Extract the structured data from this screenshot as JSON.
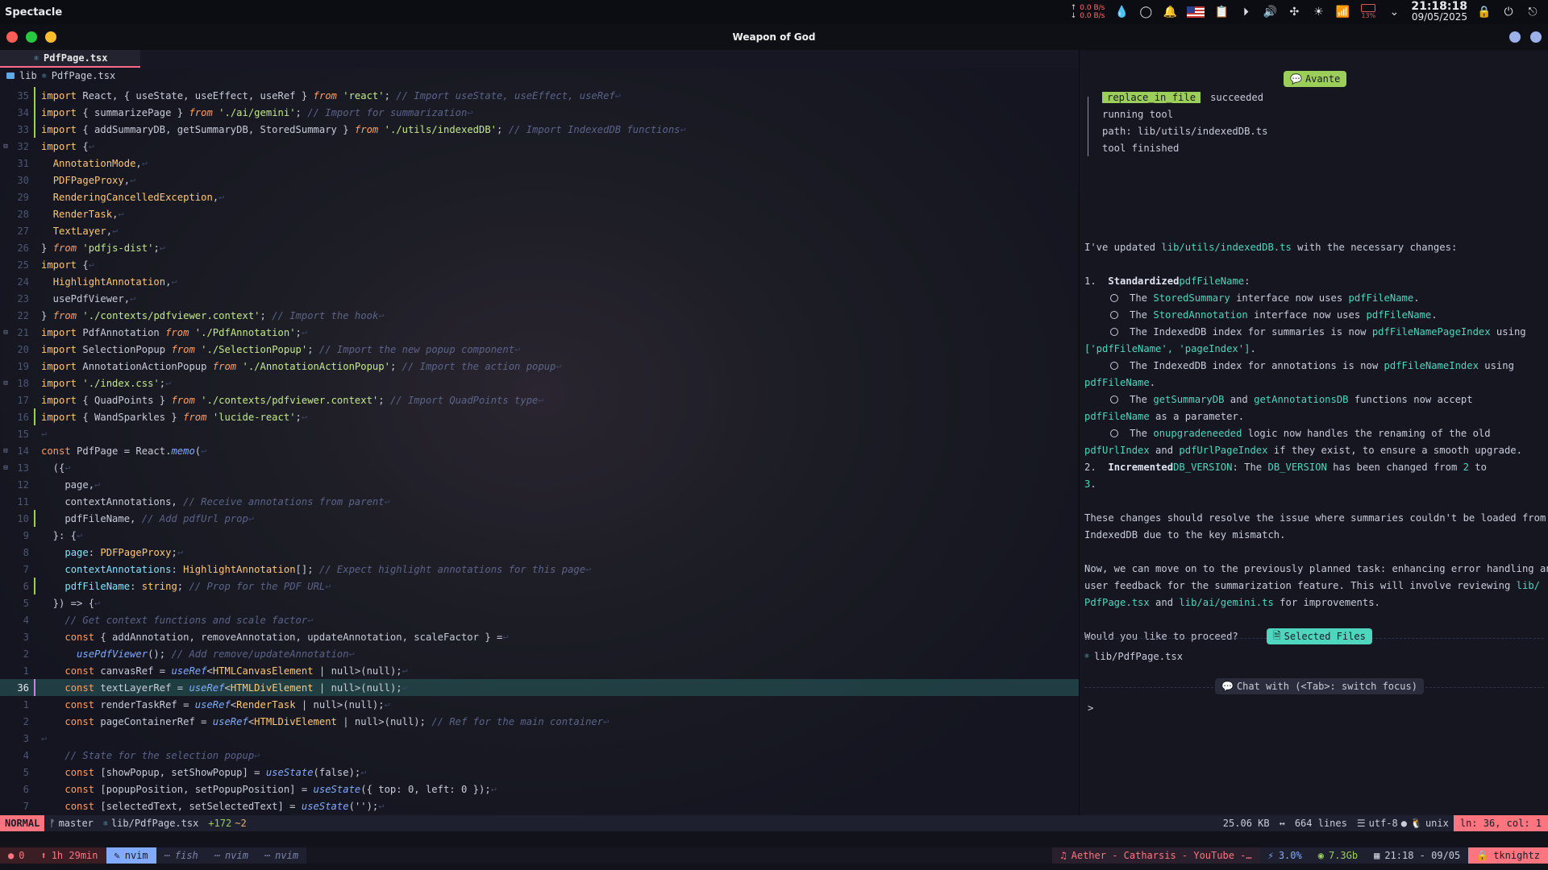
{
  "topbar": {
    "app_name": "Spectacle",
    "net_up": "0.0 B/s",
    "net_down": "0.0 B/s",
    "battery_pct": "13%",
    "time": "21:18:18",
    "date": "09/05/2025"
  },
  "window": {
    "title": "Weapon of God"
  },
  "editor": {
    "tab_label": "PdfPage.tsx",
    "breadcrumb_folder": "lib",
    "breadcrumb_file": "PdfPage.tsx",
    "lines": [
      {
        "n": "35",
        "sign": "add",
        "fold": "",
        "html": "<span class=kwi>import</span> React, { useState, useEffect, useRef } <span class=from>from</span> <span class=str>'react'</span>; <span class=cm>// Import useState, useEffect, useRef</span><span class=eol>↩</span>"
      },
      {
        "n": "34",
        "sign": "add",
        "fold": "",
        "html": "<span class=kwi>import</span> { summarizePage } <span class=from>from</span> <span class=str>'./ai/gemini'</span>; <span class=cm>// Import for summarization</span><span class=eol>↩</span>"
      },
      {
        "n": "33",
        "sign": "add",
        "fold": "",
        "html": "<span class=kwi>import</span> { addSummaryDB, getSummaryDB, StoredSummary } <span class=from>from</span> <span class=str>'./utils/indexedDB'</span>; <span class=cm>// Import IndexedDB functions</span><span class=eol>↩</span>"
      },
      {
        "n": "32",
        "sign": "",
        "fold": "⊟",
        "html": "<span class=kwi>import</span> {<span class=eol>↩</span>"
      },
      {
        "n": "31",
        "sign": "",
        "fold": "",
        "html": "  <span class=ty>AnnotationMode</span>,<span class=eol>↩</span>"
      },
      {
        "n": "30",
        "sign": "",
        "fold": "",
        "html": "  <span class=ty>PDFPageProxy</span>,<span class=eol>↩</span>"
      },
      {
        "n": "29",
        "sign": "",
        "fold": "",
        "html": "  <span class=ty>RenderingCancelledException</span>,<span class=eol>↩</span>"
      },
      {
        "n": "28",
        "sign": "",
        "fold": "",
        "html": "  <span class=ty>RenderTask</span>,<span class=eol>↩</span>"
      },
      {
        "n": "27",
        "sign": "",
        "fold": "",
        "html": "  <span class=ty>TextLayer</span>,<span class=eol>↩</span>"
      },
      {
        "n": "26",
        "sign": "",
        "fold": "",
        "html": "} <span class=from>from</span> <span class=str>'pdfjs-dist'</span>;<span class=eol>↩</span>"
      },
      {
        "n": "25",
        "sign": "",
        "fold": "",
        "html": "<span class=kwi>import</span> {<span class=eol>↩</span>"
      },
      {
        "n": "24",
        "sign": "",
        "fold": "",
        "html": "  <span class=ty>HighlightAnnotation</span>,<span class=eol>↩</span>"
      },
      {
        "n": "23",
        "sign": "",
        "fold": "",
        "html": "  usePdfViewer,<span class=eol>↩</span>"
      },
      {
        "n": "22",
        "sign": "",
        "fold": "",
        "html": "} <span class=from>from</span> <span class=str>'./contexts/pdfviewer.context'</span>; <span class=cm>// Import the hook</span><span class=eol>↩</span>"
      },
      {
        "n": "21",
        "sign": "",
        "fold": "⊟",
        "html": "<span class=kwi>import</span> PdfAnnotation <span class=from>from</span> <span class=str>'./PdfAnnotation'</span>;<span class=eol>↩</span>"
      },
      {
        "n": "20",
        "sign": "",
        "fold": "",
        "html": "<span class=kwi>import</span> SelectionPopup <span class=from>from</span> <span class=str>'./SelectionPopup'</span>; <span class=cm>// Import the new popup component</span><span class=eol>↩</span>"
      },
      {
        "n": "19",
        "sign": "",
        "fold": "",
        "html": "<span class=kwi>import</span> AnnotationActionPopup <span class=from>from</span> <span class=str>'./AnnotationActionPopup'</span>; <span class=cm>// Import the action popup</span><span class=eol>↩</span>"
      },
      {
        "n": "18",
        "sign": "",
        "fold": "⊟",
        "html": "<span class=kwi>import</span> <span class=str>'./index.css'</span>;<span class=eol>↩</span>"
      },
      {
        "n": "17",
        "sign": "",
        "fold": "",
        "html": "<span class=kwi>import</span> { QuadPoints } <span class=from>from</span> <span class=str>'./contexts/pdfviewer.context'</span>; <span class=cm>// Import QuadPoints type</span><span class=eol>↩</span>"
      },
      {
        "n": "16",
        "sign": "add",
        "fold": "",
        "html": "<span class=kwi>import</span> { WandSparkles } <span class=from>from</span> <span class=str>'lucide-react'</span>;<span class=eol>↩</span>"
      },
      {
        "n": "15",
        "sign": "",
        "fold": "",
        "html": "<span class=eol>↩</span>"
      },
      {
        "n": "14",
        "sign": "",
        "fold": "⊟",
        "html": "<span class=kw>const</span> PdfPage = React.<span class=fn>memo</span>(<span class=eol>↩</span>"
      },
      {
        "n": "13",
        "sign": "",
        "fold": "⊟",
        "html": "  ({<span class=eol>↩</span>"
      },
      {
        "n": "12",
        "sign": "",
        "fold": "",
        "html": "    page,<span class=eol>↩</span>"
      },
      {
        "n": "11",
        "sign": "",
        "fold": "",
        "html": "    contextAnnotations, <span class=cm>// Receive annotations from parent</span><span class=eol>↩</span>"
      },
      {
        "n": "10",
        "sign": "add",
        "fold": "",
        "html": "    pdfFileName, <span class=cm>// Add pdfUrl prop</span><span class=eol>↩</span>"
      },
      {
        "n": "9",
        "sign": "",
        "fold": "",
        "html": "  }: {<span class=eol>↩</span>"
      },
      {
        "n": "8",
        "sign": "",
        "fold": "",
        "html": "    <span class=prop>page</span>: <span class=ty>PDFPageProxy</span>;<span class=eol>↩</span>"
      },
      {
        "n": "7",
        "sign": "",
        "fold": "",
        "html": "    <span class=prop>contextAnnotations</span>: <span class=ty>HighlightAnnotation</span>[]; <span class=cm>// Expect highlight annotations for this page</span><span class=eol>↩</span>"
      },
      {
        "n": "6",
        "sign": "add",
        "fold": "",
        "html": "    <span class=prop>pdfFileName</span>: <span class=ty>string</span>; <span class=cm>// Prop for the PDF URL</span><span class=eol>↩</span>"
      },
      {
        "n": "5",
        "sign": "",
        "fold": "",
        "html": "  }) => {<span class=eol>↩</span>"
      },
      {
        "n": "4",
        "sign": "",
        "fold": "",
        "html": "    <span class=cm>// Get context functions and scale factor</span><span class=eol>↩</span>"
      },
      {
        "n": "3",
        "sign": "",
        "fold": "",
        "html": "    <span class=kw>const</span> { addAnnotation, removeAnnotation, updateAnnotation, scaleFactor } =<span class=eol>↩</span>"
      },
      {
        "n": "2",
        "sign": "",
        "fold": "",
        "html": "      <span class=fn>usePdfViewer</span>(); <span class=cm>// Add remove/updateAnnotation</span><span class=eol>↩</span>"
      },
      {
        "n": "1",
        "sign": "",
        "fold": "",
        "html": "    <span class=kw>const</span> canvasRef = <span class=fn>useRef</span>&lt;<span class=ty>HTMLCanvasElement</span> | null&gt;(null);<span class=eol>↩</span>"
      },
      {
        "n": "36",
        "sign": "mod",
        "fold": "",
        "cur": true,
        "html": "    <span class=kw>const</span> textLayerRef = <span class=fn>useRef</span>&lt;<span class=ty>HTMLDivElement</span> | null&gt;(null);<span class=eol>↩</span>"
      },
      {
        "n": "1",
        "sign": "",
        "fold": "",
        "html": "    <span class=kw>const</span> renderTaskRef = <span class=fn>useRef</span>&lt;<span class=ty>RenderTask</span> | null&gt;(null);<span class=eol>↩</span>"
      },
      {
        "n": "2",
        "sign": "",
        "fold": "",
        "html": "    <span class=kw>const</span> pageContainerRef = <span class=fn>useRef</span>&lt;<span class=ty>HTMLDivElement</span> | null&gt;(null); <span class=cm>// Ref for the main container</span><span class=eol>↩</span>"
      },
      {
        "n": "3",
        "sign": "",
        "fold": "",
        "html": "<span class=eol>↩</span>"
      },
      {
        "n": "4",
        "sign": "",
        "fold": "",
        "html": "    <span class=cm>// State for the selection popup</span><span class=eol>↩</span>"
      },
      {
        "n": "5",
        "sign": "",
        "fold": "",
        "html": "    <span class=kw>const</span> [showPopup, setShowPopup] = <span class=fn>useState</span>(false);<span class=eol>↩</span>"
      },
      {
        "n": "6",
        "sign": "",
        "fold": "",
        "html": "    <span class=kw>const</span> [popupPosition, setPopupPosition] = <span class=fn>useState</span>({ top: 0, left: 0 });<span class=eol>↩</span>"
      },
      {
        "n": "7",
        "sign": "",
        "fold": "",
        "html": "    <span class=kw>const</span> [selectedText, setSelectedText] = <span class=fn>useState</span>('');<span class=eol>↩</span>"
      }
    ]
  },
  "avante": {
    "badge": "Avante",
    "tool_chip": "replace_in_file",
    "tool_status": "succeeded",
    "tool_running": "running tool",
    "tool_path": "path: lib/utils/indexedDB.ts",
    "tool_finished": "tool finished",
    "body_lines": [
      "I've updated <span class=hl>lib/utils/indexedDB.ts</span> with the necessary changes:",
      "",
      "1.  <span class=bold>Standardized</span> <span class=hl>pdfFileName</span>:",
      "@@The <span class=hl>StoredSummary</span> interface now uses <span class=hl>pdfFileName</span>.",
      "@@The <span class=hl>StoredAnnotation</span> interface now uses <span class=hl>pdfFileName</span>.",
      "@@The IndexedDB index for summaries is now <span class=hl>pdfFileNamePageIndex</span> using",
      "    <span class=hl>['pdfFileName', 'pageIndex']</span>.",
      "@@The IndexedDB index for annotations is now <span class=hl>pdfFileNameIndex</span> using",
      "    <span class=hl>pdfFileName</span>.",
      "@@The <span class=hl>getSummaryDB</span> and <span class=hl>getAnnotationsDB</span> functions now accept",
      "    <span class=hl>pdfFileName</span> as a parameter.",
      "@@The <span class=hl>onupgradeneeded</span> logic now handles the renaming of the old",
      "    <span class=hl>pdfUrlIndex</span> and <span class=hl>pdfUrlPageIndex</span> if they exist, to ensure a smooth upgrade.",
      "2.  <span class=bold>Incremented</span> <span class=hl>DB_VERSION</span>: The <span class=hl>DB_VERSION</span> has been changed from <span class=hl>2</span> to",
      "    <span class=hl>3</span>.",
      "",
      "These changes should resolve the issue where summaries couldn't be loaded from",
      "IndexedDB due to the key mismatch.",
      "",
      "Now, we can move on to the previously planned task: enhancing error handling and",
      "user feedback for the summarization feature. This will involve reviewing <span class=hl>lib/</span>",
      "<span class=hl>PdfPage.tsx</span> and <span class=hl>lib/ai/gemini.ts</span> for improvements.",
      "",
      "Would you like to proceed?"
    ],
    "selected_files_label": "Selected Files",
    "selected_file": "lib/PdfPage.tsx",
    "chat_with": "Chat with (<Tab>: switch focus)",
    "prompt": ">"
  },
  "statusline": {
    "mode": "NORMAL",
    "branch": "master",
    "file": "lib/PdfPage.tsx",
    "diff_add": "+172",
    "diff_mod": "~2",
    "size": "25.06 KB",
    "lines": "664 lines",
    "encoding": "utf-8",
    "format": "unix",
    "position": "ln: 36, col: 1"
  },
  "tmux": {
    "errors": "0",
    "uptime": "1h 29min",
    "active_window": "nvim",
    "win_fish": "fish",
    "win_nvim1": "nvim",
    "win_nvim2": "nvim",
    "music": "Aether - Catharsis - YouTube -…",
    "cpu": "3.0%",
    "mem": "7.3Gb",
    "datetime": "21:18 - 09/05",
    "user": "tknightz"
  }
}
